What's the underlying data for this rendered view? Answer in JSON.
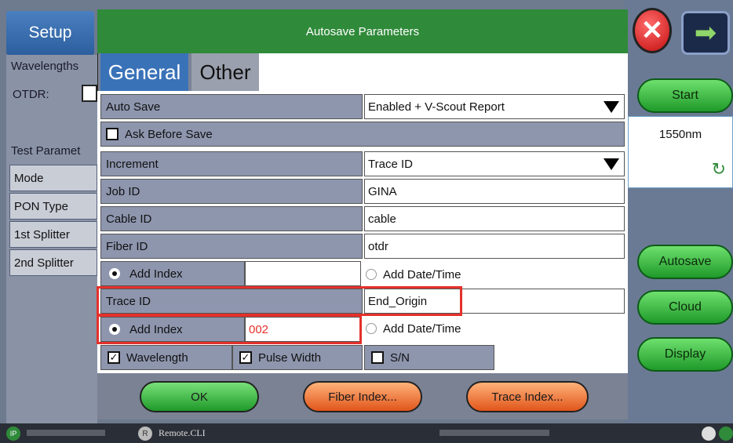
{
  "background": {
    "setup_tab": "Setup",
    "wavelengths_label": "Wavelengths",
    "otdr_label": "OTDR:",
    "test_params_label": "Test Paramet",
    "left_items": [
      "Mode",
      "PON Type",
      "1st Splitter",
      "2nd Splitter"
    ],
    "start_button": "Start",
    "wavelength_value": "1550nm",
    "autosave_button": "Autosave",
    "cloud_button": "Cloud",
    "display_button": "Display"
  },
  "dialog": {
    "title": "Autosave Parameters",
    "tabs": [
      {
        "label": "General"
      },
      {
        "label": "Other"
      }
    ],
    "auto_save": {
      "label": "Auto Save",
      "value": "Enabled + V-Scout Report"
    },
    "ask_before_save": {
      "label": "Ask Before Save",
      "checked": false
    },
    "increment": {
      "label": "Increment",
      "value": "Trace ID"
    },
    "job_id": {
      "label": "Job ID",
      "value": "GINA"
    },
    "cable_id": {
      "label": "Cable ID",
      "value": "cable"
    },
    "fiber_id": {
      "label": "Fiber ID",
      "value": "otdr"
    },
    "fiber_add_index": {
      "label": "Add Index",
      "value": "",
      "selected": true
    },
    "fiber_add_datetime": {
      "label": "Add Date/Time",
      "selected": false
    },
    "trace_id": {
      "label": "Trace ID",
      "value": "End_Origin"
    },
    "trace_add_index": {
      "label": "Add Index",
      "value": "002",
      "selected": true
    },
    "trace_add_datetime": {
      "label": "Add Date/Time",
      "selected": false
    },
    "wavelength_chk": {
      "label": "Wavelength",
      "checked": true
    },
    "pulse_width_chk": {
      "label": "Pulse Width",
      "checked": true
    },
    "sn_chk": {
      "label": "S/N",
      "checked": false
    },
    "buttons": {
      "ok": "OK",
      "fiber_index": "Fiber Index...",
      "trace_index": "Trace Index..."
    }
  },
  "status_bar": {
    "ip_label": "IP",
    "remote_label": "R",
    "remote_text": "Remote.CLI"
  },
  "colors": {
    "title_green": "#2f8a3a",
    "tab_blue": "#3a72b8",
    "highlight_red": "#e4312b"
  }
}
